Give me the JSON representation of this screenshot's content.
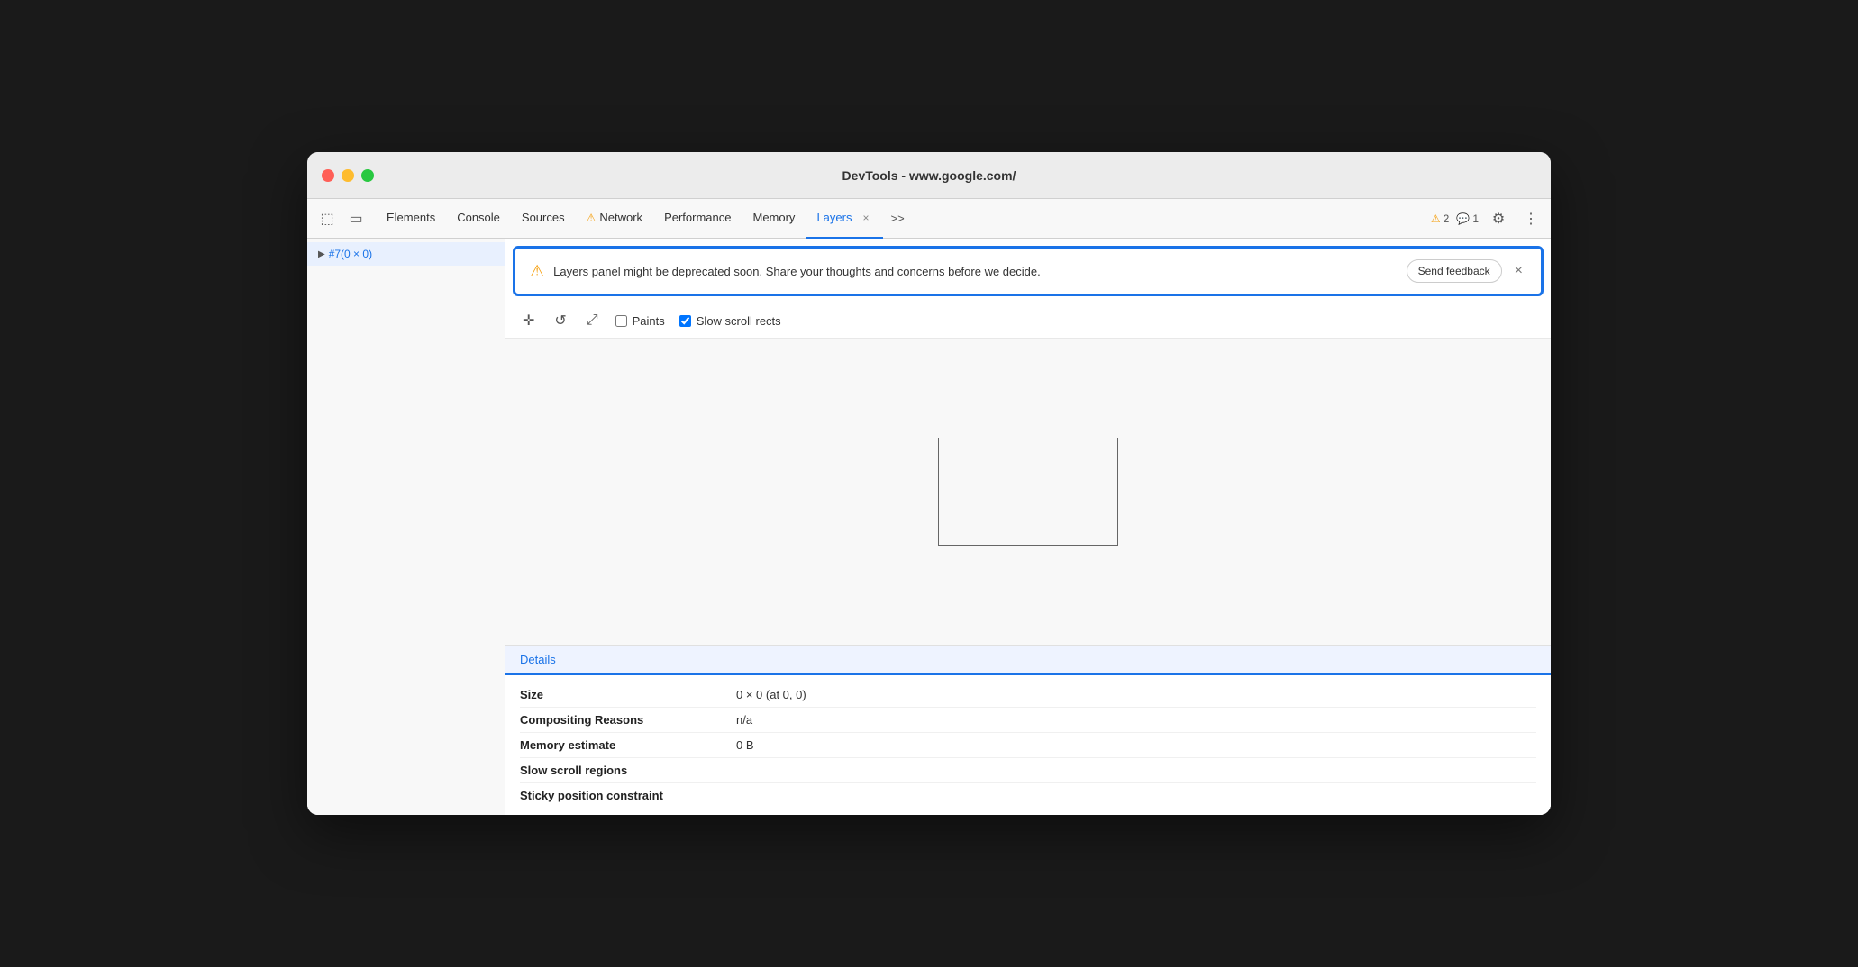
{
  "window": {
    "title": "DevTools - www.google.com/"
  },
  "titlebar_buttons": {
    "close_label": "",
    "minimize_label": "",
    "maximize_label": ""
  },
  "tabs": {
    "items": [
      {
        "id": "elements",
        "label": "Elements",
        "active": false,
        "has_warning": false
      },
      {
        "id": "console",
        "label": "Console",
        "active": false,
        "has_warning": false
      },
      {
        "id": "sources",
        "label": "Sources",
        "active": false,
        "has_warning": false
      },
      {
        "id": "network",
        "label": "Network",
        "active": false,
        "has_warning": true
      },
      {
        "id": "performance",
        "label": "Performance",
        "active": false,
        "has_warning": false
      },
      {
        "id": "memory",
        "label": "Memory",
        "active": false,
        "has_warning": false
      },
      {
        "id": "layers",
        "label": "Layers",
        "active": true,
        "has_warning": false
      }
    ],
    "more_label": ">>",
    "warnings_count": "2",
    "info_count": "1"
  },
  "sidebar": {
    "items": [
      {
        "id": "layer1",
        "label": "#7(0 × 0)",
        "selected": true
      }
    ]
  },
  "warning_banner": {
    "message": "Layers panel might be deprecated soon. Share your thoughts and concerns before we decide.",
    "send_feedback_label": "Send feedback",
    "close_label": "×"
  },
  "toolbar": {
    "pan_icon": "✛",
    "rotate_icon": "↺",
    "fit_icon": "⤢",
    "paints_label": "Paints",
    "slow_scroll_label": "Slow scroll rects",
    "paints_checked": false,
    "slow_scroll_checked": true
  },
  "details": {
    "tab_label": "Details",
    "rows": [
      {
        "key": "Size",
        "value": "0 × 0 (at 0, 0)"
      },
      {
        "key": "Compositing Reasons",
        "value": "n/a"
      },
      {
        "key": "Memory estimate",
        "value": "0 B"
      },
      {
        "key": "Slow scroll regions",
        "value": ""
      },
      {
        "key": "Sticky position constraint",
        "value": ""
      }
    ]
  },
  "icons": {
    "close": "×",
    "settings": "⚙",
    "more_vert": "⋮",
    "warning_triangle": "⚠",
    "cursor": "⬚",
    "mobile": "⬜"
  }
}
